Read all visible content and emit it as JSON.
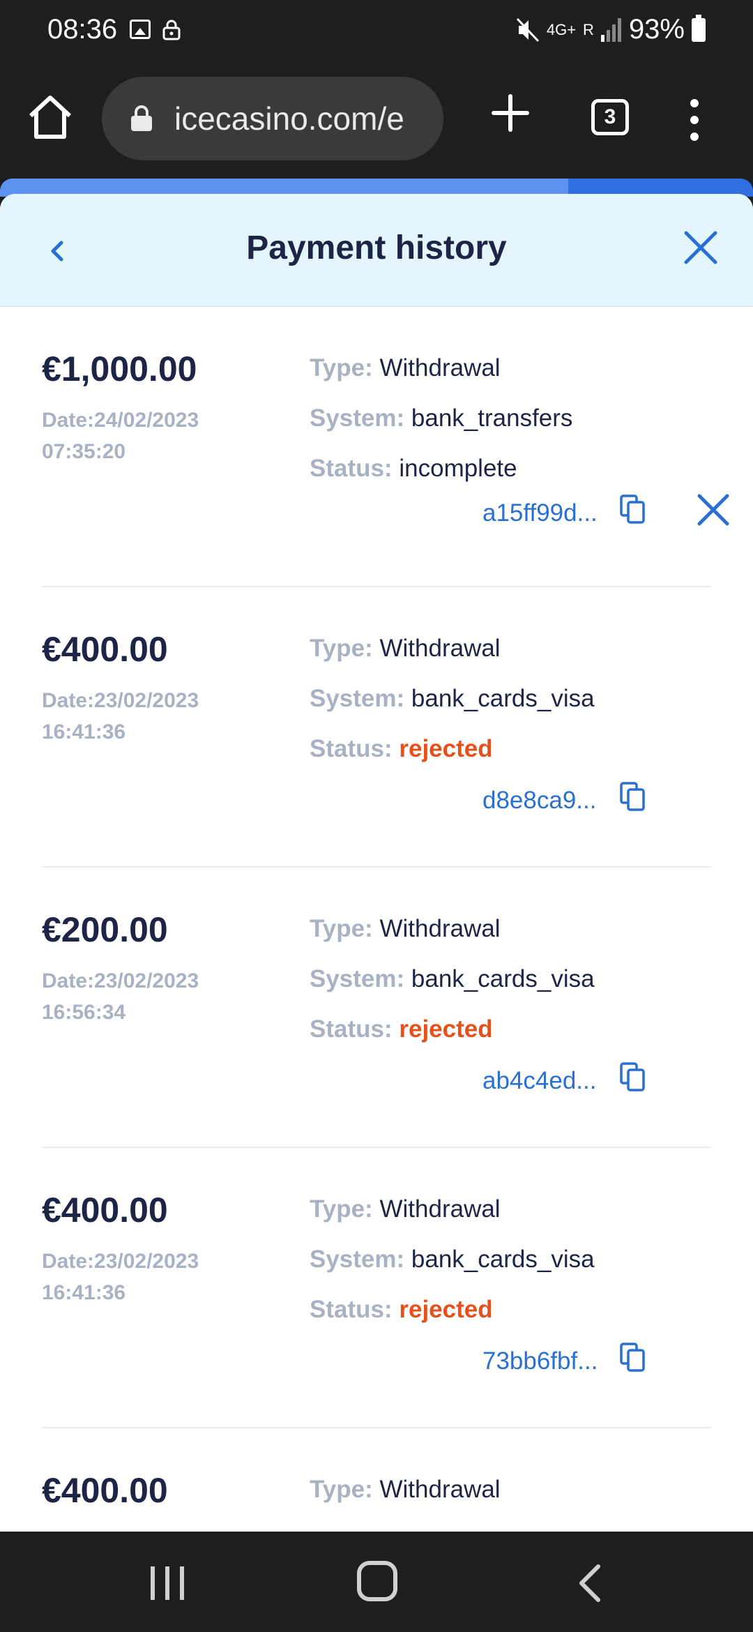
{
  "status_bar": {
    "time": "08:36",
    "network": "4G+",
    "signal_label": "R",
    "battery": "93%"
  },
  "browser": {
    "url": "icecasino.com/e",
    "tab_count": "3",
    "page_load_progress": 0.755
  },
  "modal": {
    "title": "Payment history"
  },
  "labels": {
    "type": "Type:",
    "system": "System:",
    "status": "Status:"
  },
  "transactions": [
    {
      "amount": "€1,000.00",
      "date_line1": "Date:24/02/2023",
      "date_line2": "07:35:20",
      "type": "Withdrawal",
      "system": "bank_transfers",
      "status": "incomplete",
      "id": "a15ff99d..."
    },
    {
      "amount": "€400.00",
      "date_line1": "Date:23/02/2023",
      "date_line2": "16:41:36",
      "type": "Withdrawal",
      "system": "bank_cards_visa",
      "status": "rejected",
      "id": "d8e8ca9..."
    },
    {
      "amount": "€200.00",
      "date_line1": "Date:23/02/2023",
      "date_line2": "16:56:34",
      "type": "Withdrawal",
      "system": "bank_cards_visa",
      "status": "rejected",
      "id": "ab4c4ed..."
    },
    {
      "amount": "€400.00",
      "date_line1": "Date:23/02/2023",
      "date_line2": "16:41:36",
      "type": "Withdrawal",
      "system": "bank_cards_visa",
      "status": "rejected",
      "id": "73bb6fbf..."
    },
    {
      "amount": "€400.00",
      "type": "Withdrawal"
    }
  ],
  "colors": {
    "accent": "#2a6fd3",
    "rejected": "#e6501b",
    "header_bg": "#e4f6fd",
    "text_dark": "#1d2445",
    "text_muted": "#a8b2c3"
  }
}
